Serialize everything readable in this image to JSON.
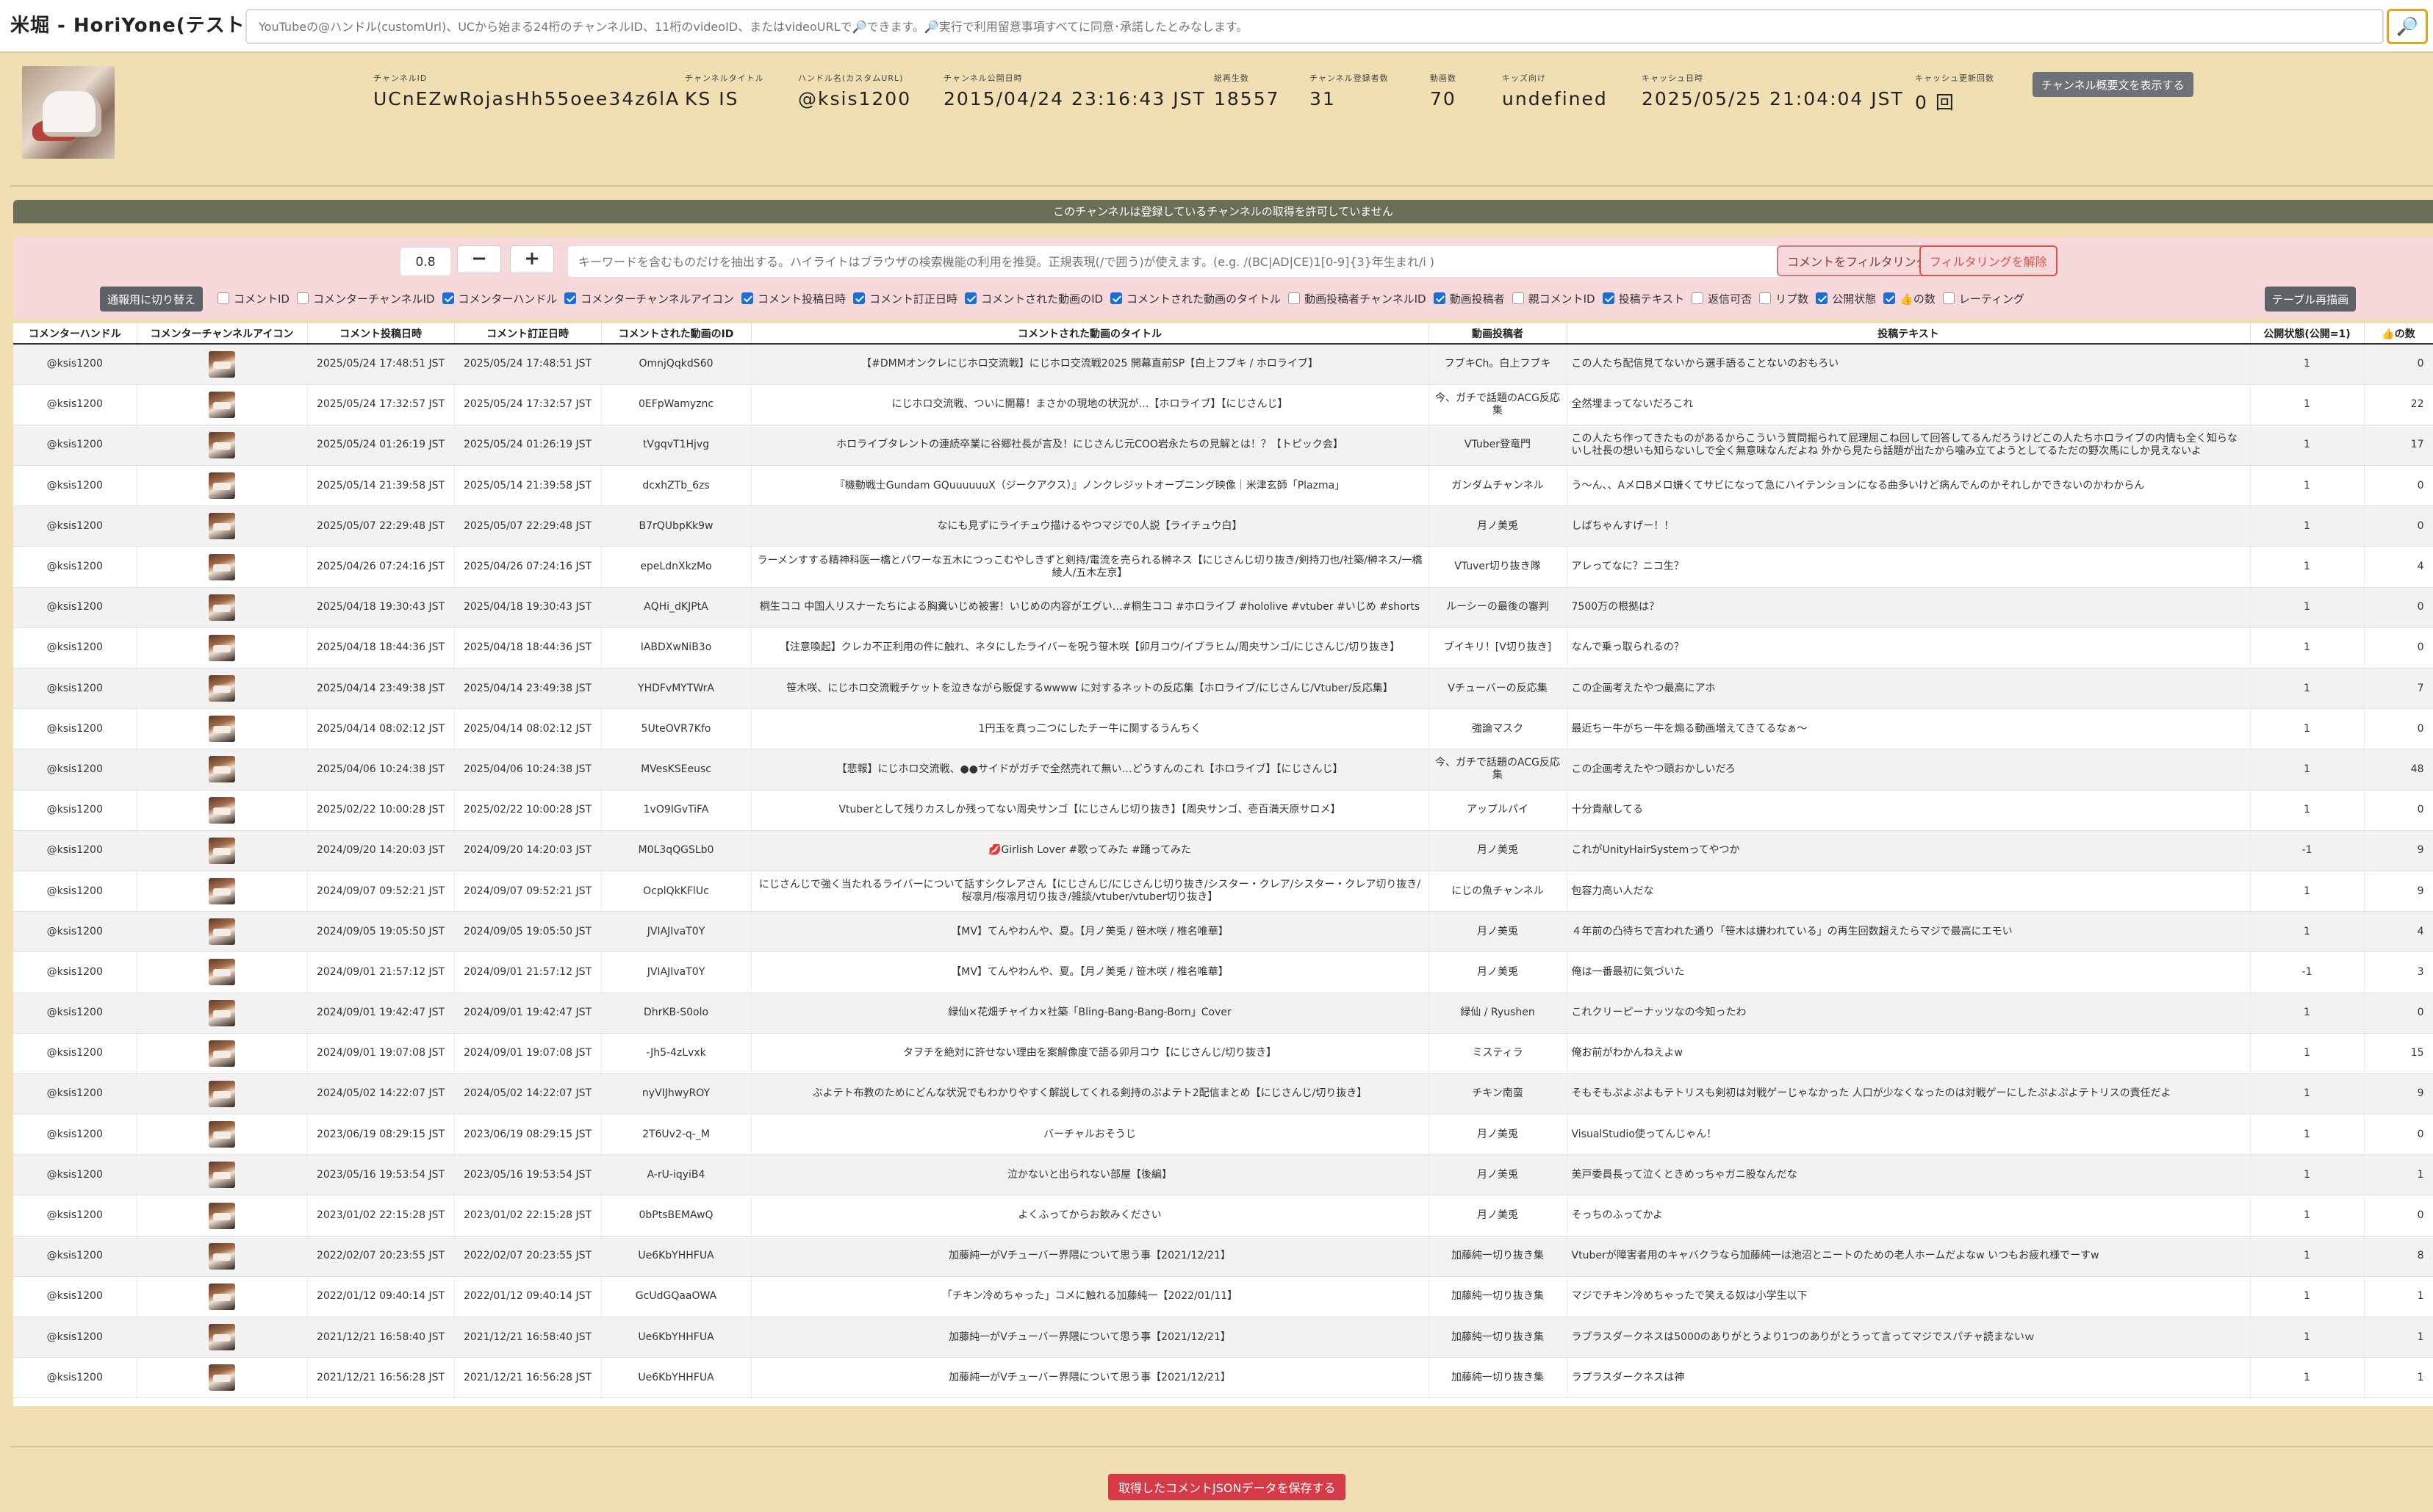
{
  "app": {
    "title": "米堀 - HoriYone(テスト中)",
    "search_placeholder": "YouTubeの@ハンドル(customUrl)、UCから始まる24桁のチャンネルID、11桁のvideoID、またはvideoURLで🔎できます。🔎実行で利用留意事項すべてに同意･承諾したとみなします。",
    "search_icon": "🔎"
  },
  "channel": {
    "fields": [
      {
        "label": "チャンネルID",
        "value": "UCnEZwRojasHh55oee34z6lA"
      },
      {
        "label": "チャンネルタイトル",
        "value": "KS IS"
      },
      {
        "label": "ハンドル名(カスタムURL)",
        "value": "@ksis1200"
      },
      {
        "label": "チャンネル公開日時",
        "value": "2015/04/24 23:16:43 JST"
      },
      {
        "label": "総再生数",
        "value": "18557"
      },
      {
        "label": "チャンネル登録者数",
        "value": "31"
      },
      {
        "label": "動画数",
        "value": "70"
      },
      {
        "label": "キッズ向け",
        "value": "undefined"
      },
      {
        "label": "キャッシュ日時",
        "value": "2025/05/25 21:04:04 JST"
      },
      {
        "label": "キャッシュ更新回数",
        "value": "0 回"
      }
    ],
    "description_button": "チャンネル概要文を表示する"
  },
  "notice": "このチャンネルは登録しているチャンネルの取得を許可していません",
  "filter": {
    "zoom_value": "0.8",
    "minus_label": "−",
    "plus_label": "+",
    "keyword_placeholder": "キーワードを含むものだけを抽出する。ハイライトはブラウザの検索機能の利用を推奨。正規表現(/で囲う)が使えます。(e.g. /(BC|AD|CE)1[0-9]{3}年生まれ/i )",
    "filter_button": "コメントをフィルタリング",
    "clear_button": "フィルタリングを解除",
    "switch_button": "通報用に切り替え",
    "redraw_button": "テーブル再描画",
    "toggles": [
      {
        "label": "コメントID",
        "checked": false
      },
      {
        "label": "コメンターチャンネルID",
        "checked": false
      },
      {
        "label": "コメンターハンドル",
        "checked": true
      },
      {
        "label": "コメンターチャンネルアイコン",
        "checked": true
      },
      {
        "label": "コメント投稿日時",
        "checked": true
      },
      {
        "label": "コメント訂正日時",
        "checked": true
      },
      {
        "label": "コメントされた動画のID",
        "checked": true
      },
      {
        "label": "コメントされた動画のタイトル",
        "checked": true
      },
      {
        "label": "動画投稿者チャンネルID",
        "checked": false
      },
      {
        "label": "動画投稿者",
        "checked": true
      },
      {
        "label": "親コメントID",
        "checked": false
      },
      {
        "label": "投稿テキスト",
        "checked": true
      },
      {
        "label": "返信可否",
        "checked": false
      },
      {
        "label": "リプ数",
        "checked": false
      },
      {
        "label": "公開状態",
        "checked": true
      },
      {
        "label": "👍の数",
        "checked": true
      },
      {
        "label": "レーティング",
        "checked": false
      }
    ]
  },
  "table": {
    "headers": [
      "コメンターハンドル",
      "コメンターチャンネルアイコン",
      "コメント投稿日時",
      "コメント訂正日時",
      "コメントされた動画のID",
      "コメントされた動画のタイトル",
      "動画投稿者",
      "投稿テキスト",
      "公開状態(公開=1)",
      "👍の数"
    ],
    "rows": [
      [
        "@ksis1200",
        "2025/05/24 17:48:51 JST",
        "2025/05/24 17:48:51 JST",
        "OmnjQqkdS60",
        "【#DMMオンクレにじホロ交流戦】にじホロ交流戦2025 開幕直前SP【白上フブキ / ホロライブ】",
        "フブキCh。白上フブキ",
        "この人たち配信見てないから選手語ることないのおもろい",
        "1",
        "0"
      ],
      [
        "@ksis1200",
        "2025/05/24 17:32:57 JST",
        "2025/05/24 17:32:57 JST",
        "0EFpWamyznc",
        "にじホロ交流戦、ついに開幕！まさかの現地の状況が…【ホロライブ】【にじさんじ】",
        "今、ガチで話題のACG反応集",
        "全然埋まってないだろこれ",
        "1",
        "22"
      ],
      [
        "@ksis1200",
        "2025/05/24 01:26:19 JST",
        "2025/05/24 01:26:19 JST",
        "tVgqvT1Hjvg",
        "ホロライブタレントの連続卒業に谷郷社長が言及！にじさんじ元COO岩永たちの見解とは！？【トピック会】",
        "VTuber登竜門",
        "この人たち作ってきたものがあるからこういう質問掘られて屁理屈こね回して回答してるんだろうけどこの人たちホロライブの内情も全く知らないし社長の想いも知らないしで全く無意味なんだよね 外から見たら話題が出たから噛み立てようとしてるただの野次馬にしか見えないよ",
        "1",
        "17"
      ],
      [
        "@ksis1200",
        "2025/05/14 21:39:58 JST",
        "2025/05/14 21:39:58 JST",
        "dcxhZTb_6zs",
        "『機動戦士Gundam GQuuuuuuX（ジークアクス）』ノンクレジットオープニング映像｜米津玄師「Plazma」",
        "ガンダムチャンネル",
        "う〜ん、、AメロBメロ嫌くてサビになって急にハイテンションになる曲多いけど病んでんのかそれしかできないのかわからん",
        "1",
        "0"
      ],
      [
        "@ksis1200",
        "2025/05/07 22:29:48 JST",
        "2025/05/07 22:29:48 JST",
        "B7rQUbpKk9w",
        "なにも見ずにライチュウ描けるやつマジで0人説【ライチュウ白】",
        "月ノ美兎",
        "しばちゃんすげー！！",
        "1",
        "0"
      ],
      [
        "@ksis1200",
        "2025/04/26 07:24:16 JST",
        "2025/04/26 07:24:16 JST",
        "epeLdnXkzMo",
        "ラーメンすする精神科医一橋とパワーな五木につっこむやしきずと剣持/電流を売られる榊ネス【にじさんじ切り抜き/剣持刀也/社築/榊ネス/一橋綾人/五木左京】",
        "VTuver切り抜き隊",
        "アレってなに？ニコ生？",
        "1",
        "4"
      ],
      [
        "@ksis1200",
        "2025/04/18 19:30:43 JST",
        "2025/04/18 19:30:43 JST",
        "AQHi_dKJPtA",
        "桐生ココ 中国人リスナーたちによる胸糞いじめ被害！いじめの内容がエグい…#桐生ココ #ホロライブ #hololive #vtuber #いじめ #shorts",
        "ルーシーの最後の審判",
        "7500万の根拠は？",
        "1",
        "0"
      ],
      [
        "@ksis1200",
        "2025/04/18 18:44:36 JST",
        "2025/04/18 18:44:36 JST",
        "IABDXwNiB3o",
        "【注意喚起】クレカ不正利用の件に触れ、ネタにしたライバーを呪う笹木咲【卯月コウ/イブラヒム/周央サンゴ/にじさんじ/切り抜き】",
        "ブイキリ！[V切り抜き]",
        "なんで乗っ取られるの？",
        "1",
        "0"
      ],
      [
        "@ksis1200",
        "2025/04/14 23:49:38 JST",
        "2025/04/14 23:49:38 JST",
        "YHDFvMYTWrA",
        "笹木咲、にじホロ交流戦チケットを泣きながら販促するwwww に対するネットの反応集【ホロライブ/にじさんじ/Vtuber/反応集】",
        "Vチューバーの反応集",
        "この企画考えたやつ最高にアホ",
        "1",
        "7"
      ],
      [
        "@ksis1200",
        "2025/04/14 08:02:12 JST",
        "2025/04/14 08:02:12 JST",
        "5UteOVR7Kfo",
        "1円玉を真っ二つにしたチー牛に関するうんちく",
        "強論マスク",
        "最近ちー牛がちー牛を煽る動画増えてきてるなぁ〜",
        "1",
        "0"
      ],
      [
        "@ksis1200",
        "2025/04/06 10:24:38 JST",
        "2025/04/06 10:24:38 JST",
        "MVesKSEeusc",
        "【悲報】にじホロ交流戦、●●サイドがガチで全然売れて無い…どうすんのこれ【ホロライブ】【にじさんじ】",
        "今、ガチで話題のACG反応集",
        "この企画考えたやつ頭おかしいだろ",
        "1",
        "48"
      ],
      [
        "@ksis1200",
        "2025/02/22 10:00:28 JST",
        "2025/02/22 10:00:28 JST",
        "1vO9IGvTiFA",
        "Vtuberとして残りカスしか残ってない周央サンゴ【にじさんじ切り抜き】【周央サンゴ、壱百満天原サロメ】",
        "アップルパイ",
        "十分貴献してる",
        "1",
        "0"
      ],
      [
        "@ksis1200",
        "2024/09/20 14:20:03 JST",
        "2024/09/20 14:20:03 JST",
        "M0L3qQGSLb0",
        "💋Girlish Lover #歌ってみた #踊ってみた",
        "月ノ美兎",
        "これがUnityHairSystemってやつか",
        "-1",
        "9"
      ],
      [
        "@ksis1200",
        "2024/09/07 09:52:21 JST",
        "2024/09/07 09:52:21 JST",
        "OcplQkKFlUc",
        "にじさんじで強く当たれるライバーについて話すシクレアさん【にじさんじ/にじさんじ切り抜き/シスター・クレア/シスター・クレア切り抜き/桜凛月/桜凛月切り抜き/雑談/vtuber/vtuber切り抜き】",
        "にじの魚チャンネル",
        "包容力高い人だな",
        "1",
        "9"
      ],
      [
        "@ksis1200",
        "2024/09/05 19:05:50 JST",
        "2024/09/05 19:05:50 JST",
        "JVIAJIvaT0Y",
        "【MV】てんやわんや、夏。【月ノ美兎 / 笹木咲 / 椎名唯華】",
        "月ノ美兎",
        "４年前の凸待ちで言われた通り「笹木は嫌われている」の再生回数超えたらマジで最高にエモい",
        "1",
        "4"
      ],
      [
        "@ksis1200",
        "2024/09/01 21:57:12 JST",
        "2024/09/01 21:57:12 JST",
        "JVIAJIvaT0Y",
        "【MV】てんやわんや、夏。【月ノ美兎 / 笹木咲 / 椎名唯華】",
        "月ノ美兎",
        "俺は一番最初に気づいた",
        "-1",
        "3"
      ],
      [
        "@ksis1200",
        "2024/09/01 19:42:47 JST",
        "2024/09/01 19:42:47 JST",
        "DhrKB-S0olo",
        "緑仙×花畑チャイカ×社築「Bling-Bang-Bang-Born」Cover",
        "緑仙 / Ryushen",
        "これクリーピーナッツなの今知ったわ",
        "1",
        "0"
      ],
      [
        "@ksis1200",
        "2024/09/01 19:07:08 JST",
        "2024/09/01 19:07:08 JST",
        "-Jh5-4zLvxk",
        "タヲチを絶対に許せない理由を案解像度で語る卯月コウ【にじさんじ/切り抜き】",
        "ミスティラ",
        "俺お前がわかんねえよw",
        "1",
        "15"
      ],
      [
        "@ksis1200",
        "2024/05/02 14:22:07 JST",
        "2024/05/02 14:22:07 JST",
        "nyVIJhwyROY",
        "ぶよテト布教のためにどんな状況でもわかりやすく解説してくれる剣持のぷよテト2配信まとめ【にじさんじ/切り抜き】",
        "チキン南蛮",
        "そもそもぷよぷよもテトリスも剣初は対戦ゲーじゃなかった 人口が少なくなったのは対戦ゲーにしたぷよぷよテトリスの責任だよ",
        "1",
        "9"
      ],
      [
        "@ksis1200",
        "2023/06/19 08:29:15 JST",
        "2023/06/19 08:29:15 JST",
        "2T6Uv2-q-_M",
        "バーチャルおそうじ",
        "月ノ美兎",
        "VisualStudio使ってんじゃん！",
        "1",
        "0"
      ],
      [
        "@ksis1200",
        "2023/05/16 19:53:54 JST",
        "2023/05/16 19:53:54 JST",
        "A-rU-iqyiB4",
        "泣かないと出られない部屋【後編】",
        "月ノ美兎",
        "美戸委員長って泣くときめっちゃガニ股なんだな",
        "1",
        "1"
      ],
      [
        "@ksis1200",
        "2023/01/02 22:15:28 JST",
        "2023/01/02 22:15:28 JST",
        "0bPtsBEMAwQ",
        "よくふってからお飲みください",
        "月ノ美兎",
        "そっちのふってかよ",
        "1",
        "0"
      ],
      [
        "@ksis1200",
        "2022/02/07 20:23:55 JST",
        "2022/02/07 20:23:55 JST",
        "Ue6KbYHHFUA",
        "加藤純一がVチューバー界隈について思う事【2021/12/21】",
        "加藤純一切り抜き集",
        "Vtuberが障害者用のキャバクラなら加藤純一は池沼とニートのための老人ホームだよなw いつもお疲れ様でーすw",
        "1",
        "8"
      ],
      [
        "@ksis1200",
        "2022/01/12 09:40:14 JST",
        "2022/01/12 09:40:14 JST",
        "GcUdGQaaOWA",
        "「チキン冷めちゃった」コメに触れる加藤純一【2022/01/11】",
        "加藤純一切り抜き集",
        "マジでチキン冷めちゃったで笑える奴は小学生以下",
        "1",
        "1"
      ],
      [
        "@ksis1200",
        "2021/12/21 16:58:40 JST",
        "2021/12/21 16:58:40 JST",
        "Ue6KbYHHFUA",
        "加藤純一がVチューバー界隈について思う事【2021/12/21】",
        "加藤純一切り抜き集",
        "ラプラスダークネスは5000のありがとうより1つのありがとうって言ってマジでスパチャ読まないｗ",
        "1",
        "1"
      ],
      [
        "@ksis1200",
        "2021/12/21 16:56:28 JST",
        "2021/12/21 16:56:28 JST",
        "Ue6KbYHHFUA",
        "加藤純一がVチューバー界隈について思う事【2021/12/21】",
        "加藤純一切り抜き集",
        "ラプラスダークネスは神",
        "1",
        "1"
      ]
    ]
  },
  "footer": {
    "save_button": "取得したコメントJSONデータを保存する"
  }
}
